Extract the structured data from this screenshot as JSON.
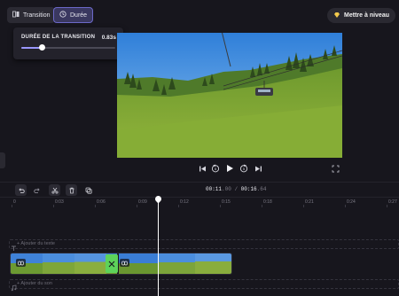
{
  "header": {
    "tab_transition": "Transition",
    "tab_duree": "Durée",
    "upgrade_label": "Mettre à niveau"
  },
  "popover": {
    "label": "DURÉE DE LA TRANSITION",
    "value": "0.83s",
    "slider_fraction": 0.22
  },
  "timeline": {
    "timecode_current_main": "00:11",
    "timecode_current_frac": ".00",
    "timecode_separator": "/",
    "timecode_total_main": "00:16",
    "timecode_total_frac": ".64",
    "ticks": [
      "0",
      "0:03",
      "0:06",
      "0:09",
      "0:12",
      "0:15",
      "0:18",
      "0:21",
      "0:24",
      "0:27"
    ],
    "add_text": "+ Ajouter du texte",
    "add_audio": "+ Ajouter du son"
  },
  "colors": {
    "accent": "#9a97ff",
    "transition_marker": "#5dd35a",
    "upgrade_icon": "#f2c94c"
  }
}
